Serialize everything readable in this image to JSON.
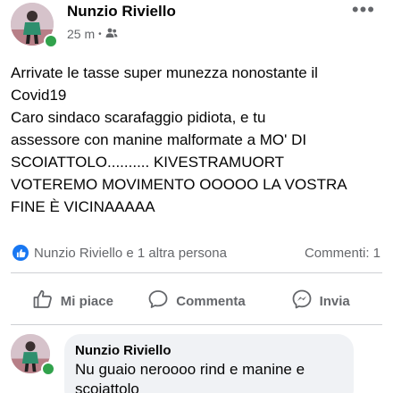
{
  "post": {
    "author": "Nunzio Riviello",
    "time": "25 m",
    "separator": "•",
    "audience_icon": "friends-icon",
    "more_icon": "more-options-icon",
    "more_label": "•••",
    "text_lines": [
      "Arrivate le tasse super munezza nonostante il",
      "Covid19",
      "Caro sindaco scarafaggio pidiota, e tu",
      "assessore con manine malformate a MO' DI",
      "SCOIATTOLO.......... KIVESTRAMUORT",
      "VOTEREMO MOVIMENTO OOOOO LA VOSTRA",
      "FINE È VICINAAAAA"
    ]
  },
  "reactions": {
    "icon": "like-reaction-icon",
    "names": "Nunzio Riviello e 1 altra persona",
    "comments": "Commenti: 1"
  },
  "actions": {
    "like": "Mi piace",
    "comment": "Commenta",
    "share": "Invia"
  },
  "comment": {
    "author": "Nunzio Riviello",
    "text_lines": [
      "Nu guaio neroooo rind e manine e",
      "scoiattolo"
    ]
  },
  "colors": {
    "accent": "#1877f2",
    "online": "#31a24c",
    "secondary_text": "#65676b",
    "bubble": "#f0f2f5"
  }
}
